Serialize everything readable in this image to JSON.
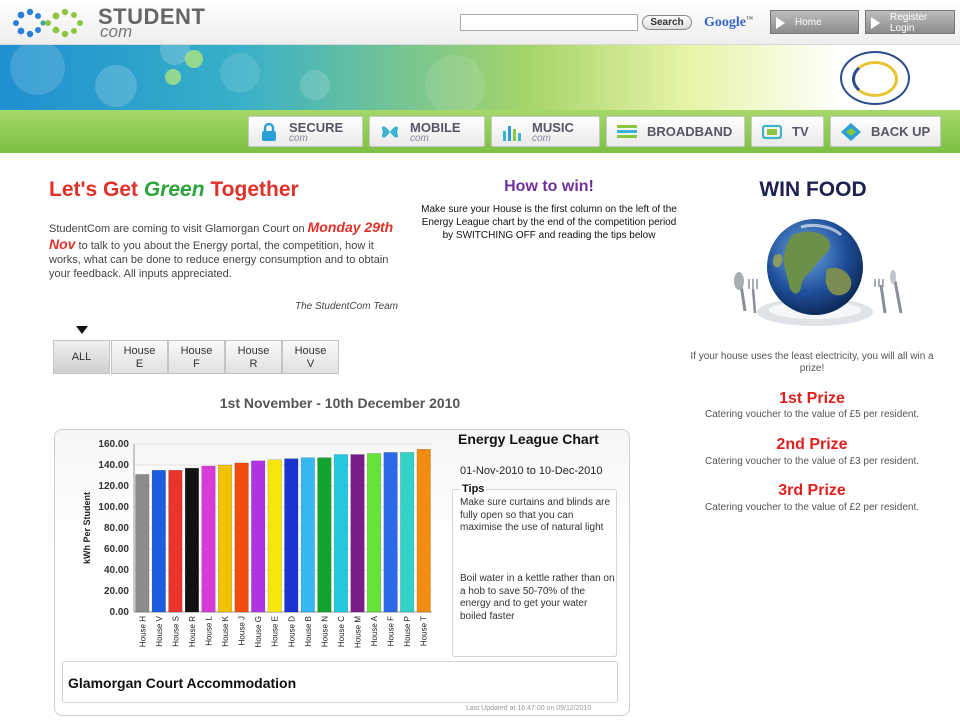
{
  "header": {
    "logo": {
      "line1": "STUDENT",
      "line2": "com"
    },
    "search": {
      "value": "",
      "button_label": "Search"
    },
    "google_label": "Google",
    "google_tm": "™",
    "home_label": "Home",
    "register_line1": "Register",
    "register_line2": "Login"
  },
  "nav": {
    "secure": {
      "label": "SECURE",
      "sub": "com"
    },
    "mobile": {
      "label": "MOBILE",
      "sub": "com"
    },
    "music": {
      "label": "MUSIC",
      "sub": "com"
    },
    "broadband": {
      "label": "BROADBAND"
    },
    "tv": {
      "label": "TV"
    },
    "backup": {
      "label": "BACK UP"
    }
  },
  "intro": {
    "heading_part1": "Let's Get ",
    "heading_green": "Green",
    "heading_part2": " Together",
    "text_before": "StudentCom are coming to visit Glamorgan Court on ",
    "date": "Monday 29th Nov",
    "text_after": " to talk to you about the Energy portal, the competition, how it works, what can be done to reduce energy consumption and to obtain your feedback. All inputs appreciated.",
    "signature": "The StudentCom Team"
  },
  "how_to_win": {
    "title": "How to win!",
    "text": "Make sure your House is the first column on the left of the Energy League chart by the end of the competition period by SWITCHING OFF and reading the tips below"
  },
  "house_tabs": [
    {
      "line1": "ALL",
      "line2": ""
    },
    {
      "line1": "House",
      "line2": "E"
    },
    {
      "line1": "House",
      "line2": "F"
    },
    {
      "line1": "House",
      "line2": "R"
    },
    {
      "line1": "House",
      "line2": "V"
    }
  ],
  "period": "1st November - 10th December 2010",
  "energy_panel": {
    "title": "Energy League Chart",
    "dates": "01-Nov-2010 to 10-Dec-2010",
    "tips_label": "Tips",
    "tip1": "Make sure curtains and blinds are fully open so that you can maximise the use of natural light",
    "tip2": "Boil water in a kettle rather than on a hob to save 50-70% of the energy and to get your water boiled faster",
    "location": "Glamorgan Court Accommodation",
    "last_updated": "Last Updated at 16:47:00 on 09/12/2010"
  },
  "chart_data": {
    "type": "bar",
    "title": "",
    "xlabel": "",
    "ylabel": "kWh Per Student",
    "ylim": [
      0,
      160
    ],
    "yticks": [
      "0.00",
      "20.00",
      "40.00",
      "60.00",
      "80.00",
      "100.00",
      "120.00",
      "140.00",
      "160.00"
    ],
    "grid": true,
    "categories": [
      "House H",
      "House V",
      "House S",
      "House R",
      "House L",
      "House K",
      "House J",
      "House G",
      "House E",
      "House D",
      "House B",
      "House N",
      "House C",
      "House M",
      "House A",
      "House F",
      "House P",
      "House T"
    ],
    "values": [
      131,
      135,
      135,
      137,
      139,
      140,
      142,
      144,
      145,
      146,
      147,
      147,
      150,
      150,
      151,
      152,
      152,
      155
    ],
    "colors": [
      "#8c8c8c",
      "#1b5fe0",
      "#e8342a",
      "#111111",
      "#d63bd6",
      "#f2c200",
      "#f24d0f",
      "#b035e0",
      "#f5e60c",
      "#1c34d0",
      "#34b8ef",
      "#13a331",
      "#22c7e0",
      "#7a1c8a",
      "#67e23a",
      "#2d68e8",
      "#32d2c9",
      "#f38c13"
    ]
  },
  "win_food": {
    "title": "WIN FOOD",
    "intro": "If your house uses the least electricity, you will all win a prize!",
    "prizes": [
      {
        "title": "1st Prize",
        "text": "Catering voucher to the value of £5 per resident."
      },
      {
        "title": "2nd Prize",
        "text": "Catering voucher to the value of £3 per resident."
      },
      {
        "title": "3rd Prize",
        "text": "Catering voucher to the value of £2 per resident."
      }
    ]
  }
}
